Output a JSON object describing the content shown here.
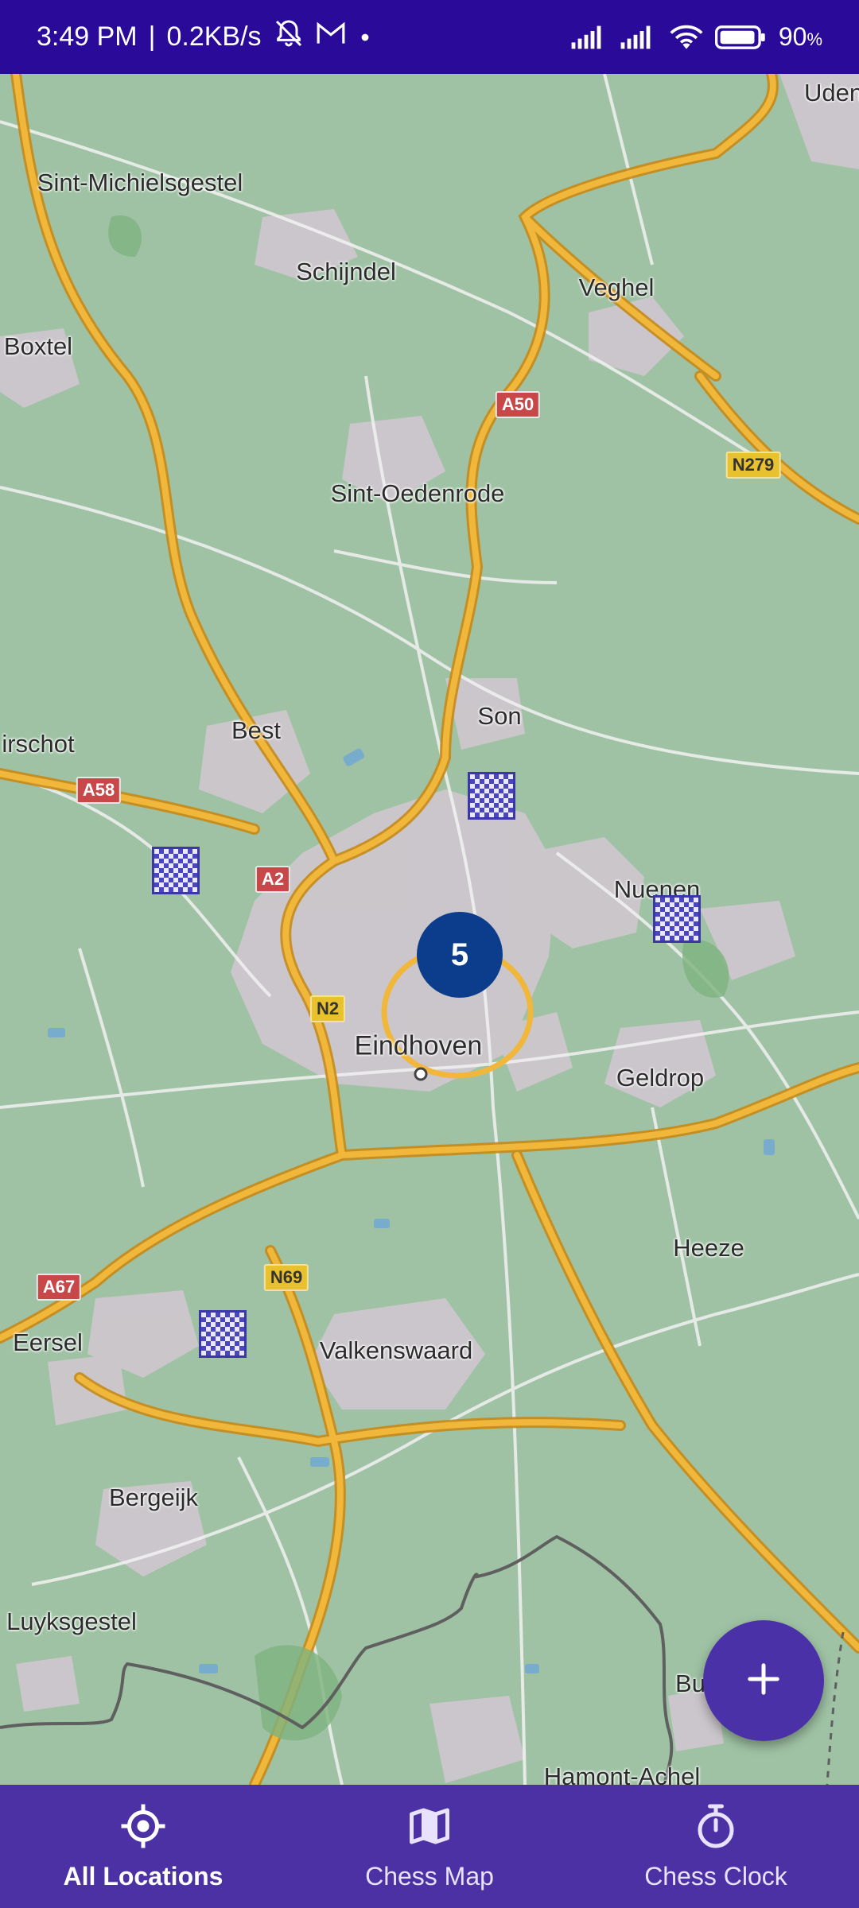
{
  "status_bar": {
    "time": "3:49 PM",
    "network_speed": "0.2KB/s",
    "battery_percent": "90",
    "battery_unit": "%",
    "icons": [
      "bell-off-icon",
      "gmail-icon",
      "dot-icon",
      "signal-icon",
      "signal-icon",
      "wifi-icon",
      "battery-icon"
    ]
  },
  "map": {
    "places": {
      "uden": "Uden",
      "sint_michielsgestel": "Sint-Michielsgestel",
      "schijndel": "Schijndel",
      "veghel": "Veghel",
      "boxtel": "Boxtel",
      "sint_oedenrode": "Sint-Oedenrode",
      "son": "Son",
      "best": "Best",
      "oirschot": "irschot",
      "nuenen": "Nuenen",
      "eindhoven": "Eindhoven",
      "geldrop": "Geldrop",
      "heeze": "Heeze",
      "eersel": "Eersel",
      "valkenswaard": "Valkenswaard",
      "bergeijk": "Bergeijk",
      "luyksgestel": "Luyksgestel",
      "budel": "Bu",
      "hamont_achel": "Hamont-Achel"
    },
    "road_shields": {
      "a50": "A50",
      "n279": "N279",
      "a58": "A58",
      "a2": "A2",
      "n2": "N2",
      "a67": "A67",
      "n69": "N69"
    },
    "cluster_count": "5",
    "marker_icon": "chessboard-icon"
  },
  "fab": {
    "icon": "plus-icon"
  },
  "bottom_nav": {
    "items": [
      {
        "label": "All Locations",
        "icon": "location-target-icon",
        "active": true
      },
      {
        "label": "Chess Map",
        "icon": "map-icon",
        "active": false
      },
      {
        "label": "Chess Clock",
        "icon": "stopwatch-icon",
        "active": false
      }
    ]
  },
  "colors": {
    "status_bar": "#2a0a98",
    "nav_bar": "#4b31a3",
    "fab": "#4b31a8",
    "cluster": "#0b3d8c",
    "map_land": "#9fc2a4",
    "road": "#e3a62b"
  }
}
